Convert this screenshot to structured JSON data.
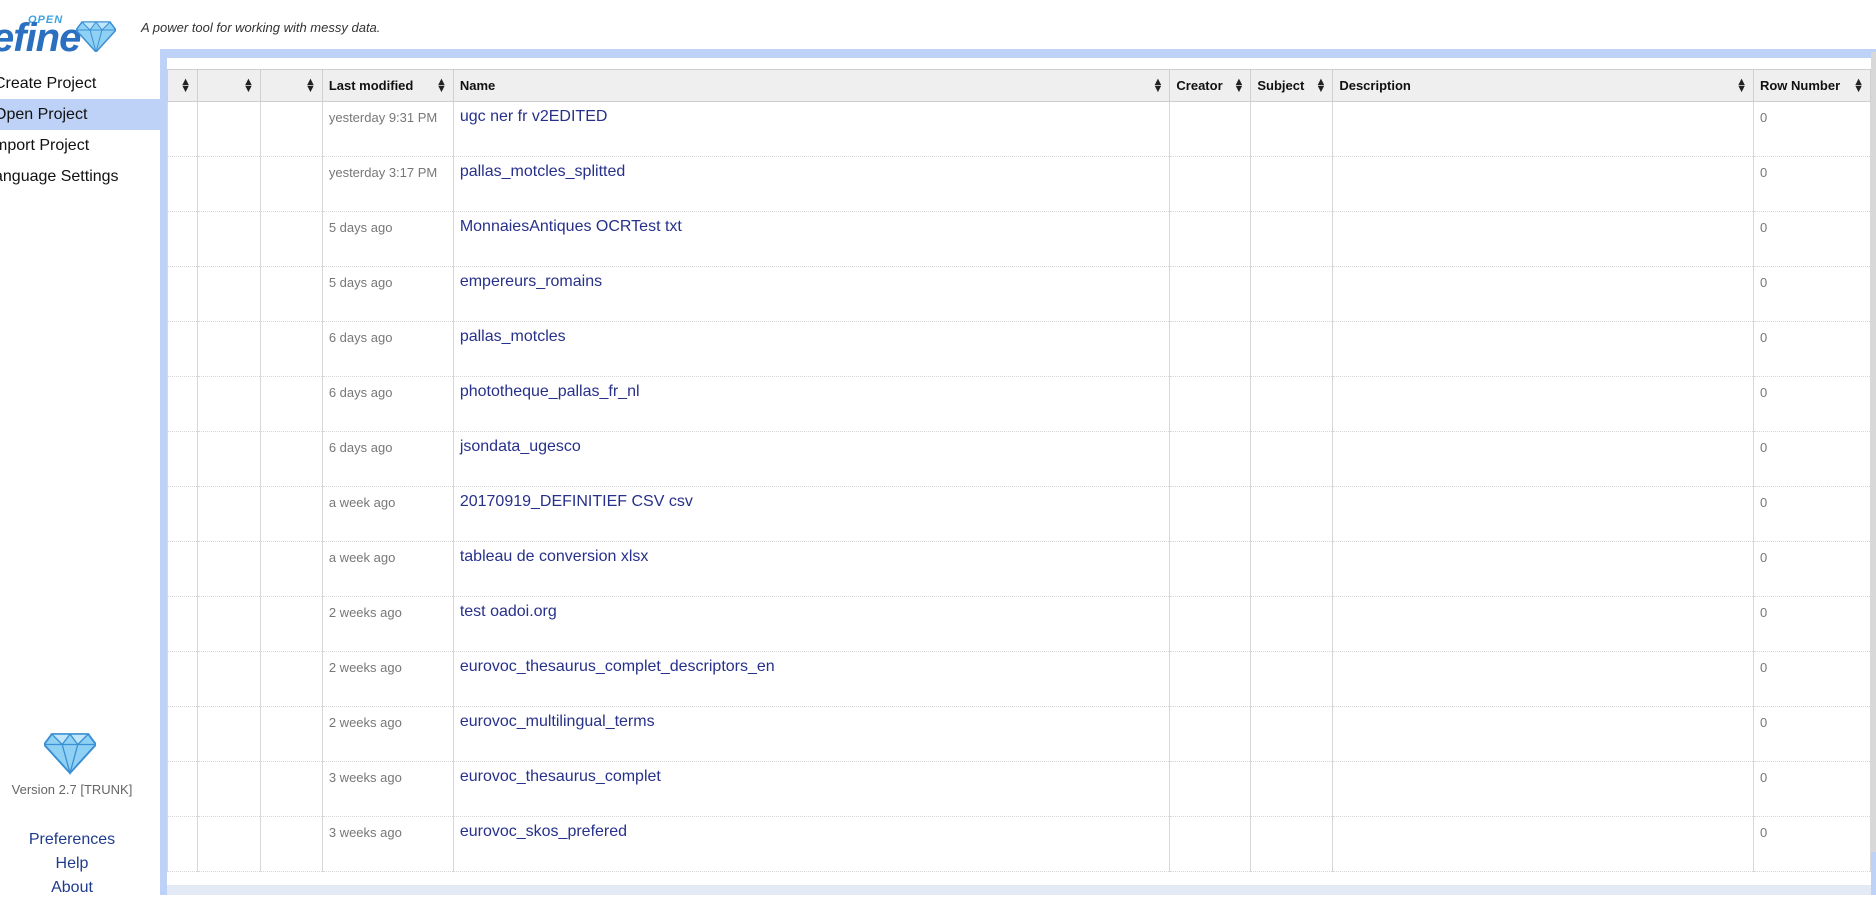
{
  "header": {
    "logo_open": "OPEN",
    "logo_refine": "efine",
    "tagline": "A power tool for working with messy data."
  },
  "nav": {
    "items": [
      {
        "label": "Create Project"
      },
      {
        "label": "Open Project"
      },
      {
        "label": "mport Project"
      },
      {
        "label": "anguage Settings"
      }
    ],
    "selected_index": 1
  },
  "left_footer": {
    "version": "Version 2.7 [TRUNK]",
    "links": [
      "Preferences",
      "Help",
      "About"
    ]
  },
  "table": {
    "columns": [
      "",
      "",
      "",
      "Last modified",
      "Name",
      "Creator",
      "Subject",
      "Description",
      "Row Number"
    ],
    "rows": [
      {
        "modified": "yesterday 9:31 PM",
        "name": "ugc ner fr v2EDITED",
        "row_number": "0"
      },
      {
        "modified": "yesterday 3:17 PM",
        "name": "pallas_motcles_splitted",
        "row_number": "0"
      },
      {
        "modified": "5 days ago",
        "name": "MonnaiesAntiques OCRTest txt",
        "row_number": "0"
      },
      {
        "modified": "5 days ago",
        "name": "empereurs_romains",
        "row_number": "0"
      },
      {
        "modified": "6 days ago",
        "name": "pallas_motcles",
        "row_number": "0"
      },
      {
        "modified": "6 days ago",
        "name": "phototheque_pallas_fr_nl",
        "row_number": "0"
      },
      {
        "modified": "6 days ago",
        "name": "jsondata_ugesco",
        "row_number": "0"
      },
      {
        "modified": "a week ago",
        "name": "20170919_DEFINITIEF CSV csv",
        "row_number": "0"
      },
      {
        "modified": "a week ago",
        "name": "tableau de conversion xlsx",
        "row_number": "0"
      },
      {
        "modified": "2 weeks ago",
        "name": "test oadoi.org",
        "row_number": "0"
      },
      {
        "modified": "2 weeks ago",
        "name": "eurovoc_thesaurus_complet_descriptors_en",
        "row_number": "0"
      },
      {
        "modified": "2 weeks ago",
        "name": "eurovoc_multilingual_terms",
        "row_number": "0"
      },
      {
        "modified": "3 weeks ago",
        "name": "eurovoc_thesaurus_complet",
        "row_number": "0"
      },
      {
        "modified": "3 weeks ago",
        "name": "eurovoc_skos_prefered",
        "row_number": "0"
      }
    ]
  },
  "colors": {
    "accent_blue": "#bdd2f6",
    "link_blue": "#27308a",
    "logo_blue": "#2b6fc0"
  },
  "icons": {
    "sort": "sort-arrows-icon",
    "diamond": "diamond-logo-icon"
  }
}
